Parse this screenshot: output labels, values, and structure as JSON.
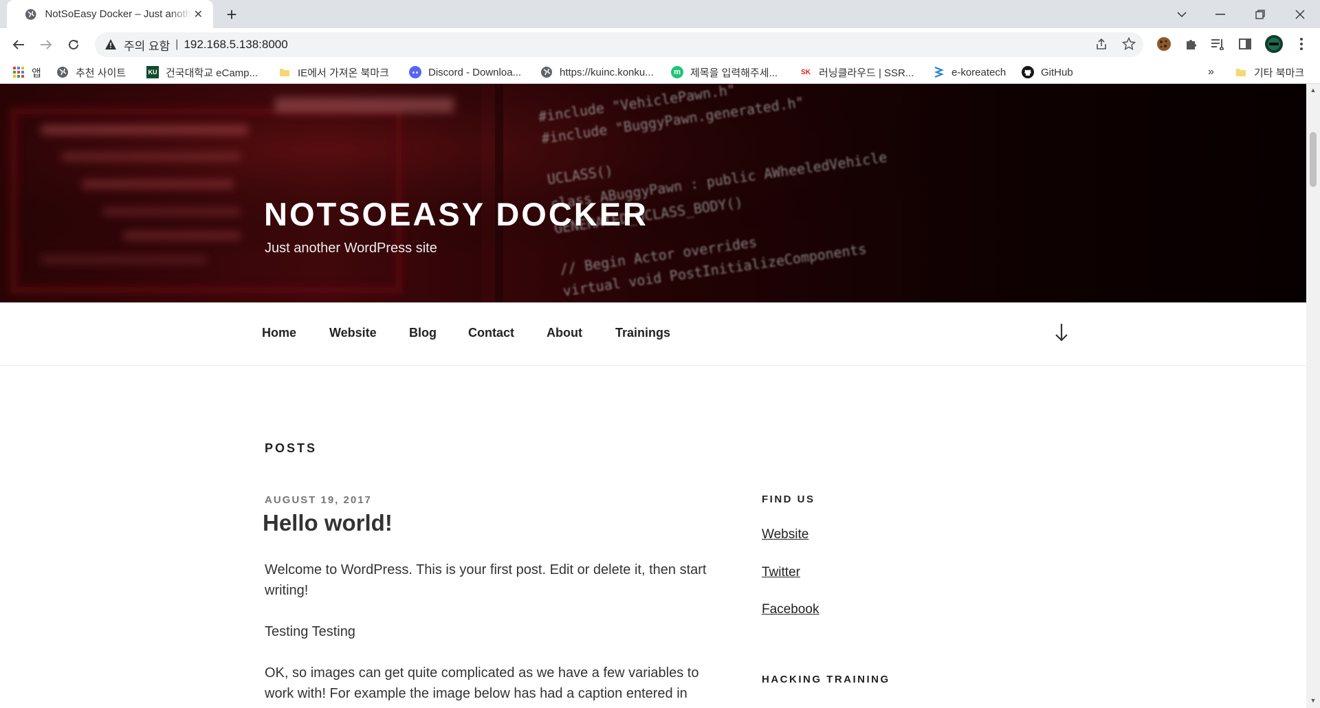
{
  "browser": {
    "tab": {
      "title": "NotSoEasy Docker – Just anothe",
      "close_glyph": "✕"
    },
    "new_tab_glyph": "+",
    "omnibox": {
      "security_label": "주의 요함",
      "separator": "|",
      "url": "192.168.5.138:8000"
    },
    "bookmarks": [
      {
        "label": "앱",
        "icon": "apps-grid-icon"
      },
      {
        "label": "추천 사이트",
        "icon": "globe-icon"
      },
      {
        "label": "건국대학교 eCamp...",
        "icon": "ku-icon",
        "icon_text": "KU"
      },
      {
        "label": "IE에서 가져온 북마크",
        "icon": "folder-icon"
      },
      {
        "label": "Discord - Downloa...",
        "icon": "discord-icon"
      },
      {
        "label": "https://kuinc.konku...",
        "icon": "globe-icon"
      },
      {
        "label": "제목을 입력해주세...",
        "icon": "m-icon",
        "icon_text": "m"
      },
      {
        "label": "러닝클라우드 | SSR...",
        "icon": "sk-icon",
        "icon_text": "SK"
      },
      {
        "label": "e-koreatech",
        "icon": "e-koreatech-icon"
      },
      {
        "label": "GitHub",
        "icon": "github-icon"
      }
    ],
    "bookmarks_overflow": "»",
    "other_bookmarks": "기타 북마크"
  },
  "site": {
    "title": "NOTSOEASY DOCKER",
    "description": "Just another WordPress site",
    "nav": [
      "Home",
      "Website",
      "Blog",
      "Contact",
      "About",
      "Trainings"
    ]
  },
  "main": {
    "posts_heading": "POSTS",
    "post": {
      "date": "AUGUST 19, 2017",
      "title": "Hello world!",
      "paragraphs": [
        "Welcome to WordPress. This is your first post. Edit or delete it, then start writing!",
        "Testing Testing",
        "OK, so images can get quite complicated as we have a few variables to work with! For example the image below has had a caption entered in"
      ]
    }
  },
  "sidebar": {
    "find_us_title": "FIND US",
    "links": [
      "Website",
      "Twitter",
      "Facebook"
    ],
    "hacking_title": "HACKING TRAINING"
  },
  "colors": {
    "header_accent": "#5a0c10",
    "link": "#222222",
    "chrome_bg": "#dee1e6"
  }
}
